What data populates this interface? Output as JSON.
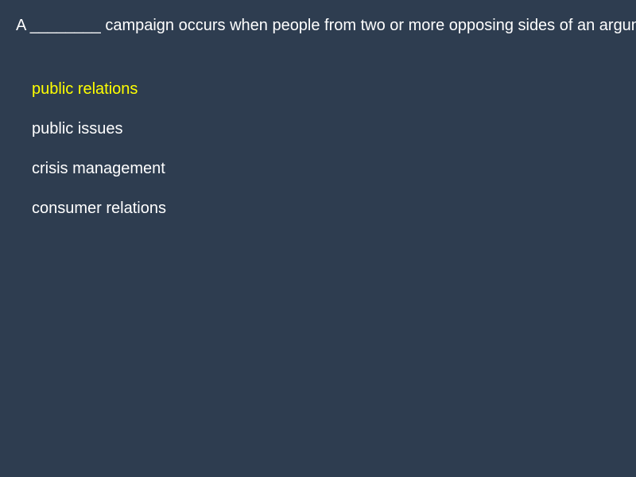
{
  "question": {
    "text": "A ________ campaign occurs when people from two or more opposing sides of an argum"
  },
  "answers": [
    {
      "label": "public relations",
      "selected": true
    },
    {
      "label": "public issues",
      "selected": false
    },
    {
      "label": "crisis management",
      "selected": false
    },
    {
      "label": "consumer relations",
      "selected": false
    }
  ],
  "colors": {
    "background": "#2e3d50",
    "text": "#ffffff",
    "selected": "#ffff00"
  }
}
